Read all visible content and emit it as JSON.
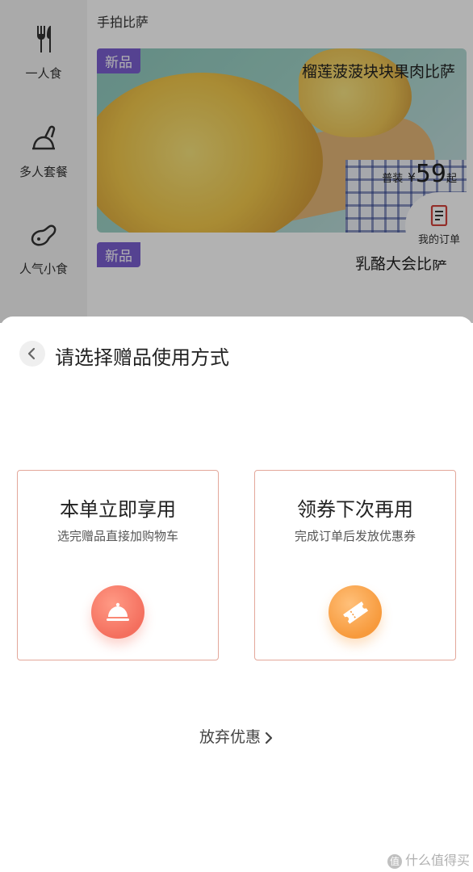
{
  "background": {
    "sidebar": {
      "items": [
        {
          "label": "一人食",
          "icon": "utensils-icon"
        },
        {
          "label": "多人套餐",
          "icon": "food-platter-icon"
        },
        {
          "label": "人气小食",
          "icon": "snack-icon"
        }
      ]
    },
    "section_title": "手拍比萨",
    "products": [
      {
        "badge": "新品",
        "name": "榴莲菠菠块块果肉比萨",
        "price_prefix": "普装",
        "currency": "¥",
        "price": "59",
        "price_suffix": "起"
      },
      {
        "badge": "新品",
        "name": "乳酪大会比萨"
      }
    ],
    "order_button": {
      "label": "我的订单",
      "icon": "order-list-icon"
    }
  },
  "sheet": {
    "title": "请选择赠品使用方式",
    "options": [
      {
        "title": "本单立即享用",
        "subtitle": "选完赠品直接加购物车",
        "icon": "dish-cover-icon",
        "color": "#f46f5e"
      },
      {
        "title": "领券下次再用",
        "subtitle": "完成订单后发放优惠券",
        "icon": "coupon-ticket-icon",
        "color": "#f79a3c"
      }
    ],
    "giveup_label": "放弃优惠"
  },
  "watermark": {
    "text": "什么值得买",
    "logo_glyph": "值"
  },
  "colors": {
    "card_border": "#e3a79a",
    "badge_purple": "#7a5fd0",
    "dim_overlay": "rgba(0,0,0,0.30)"
  }
}
